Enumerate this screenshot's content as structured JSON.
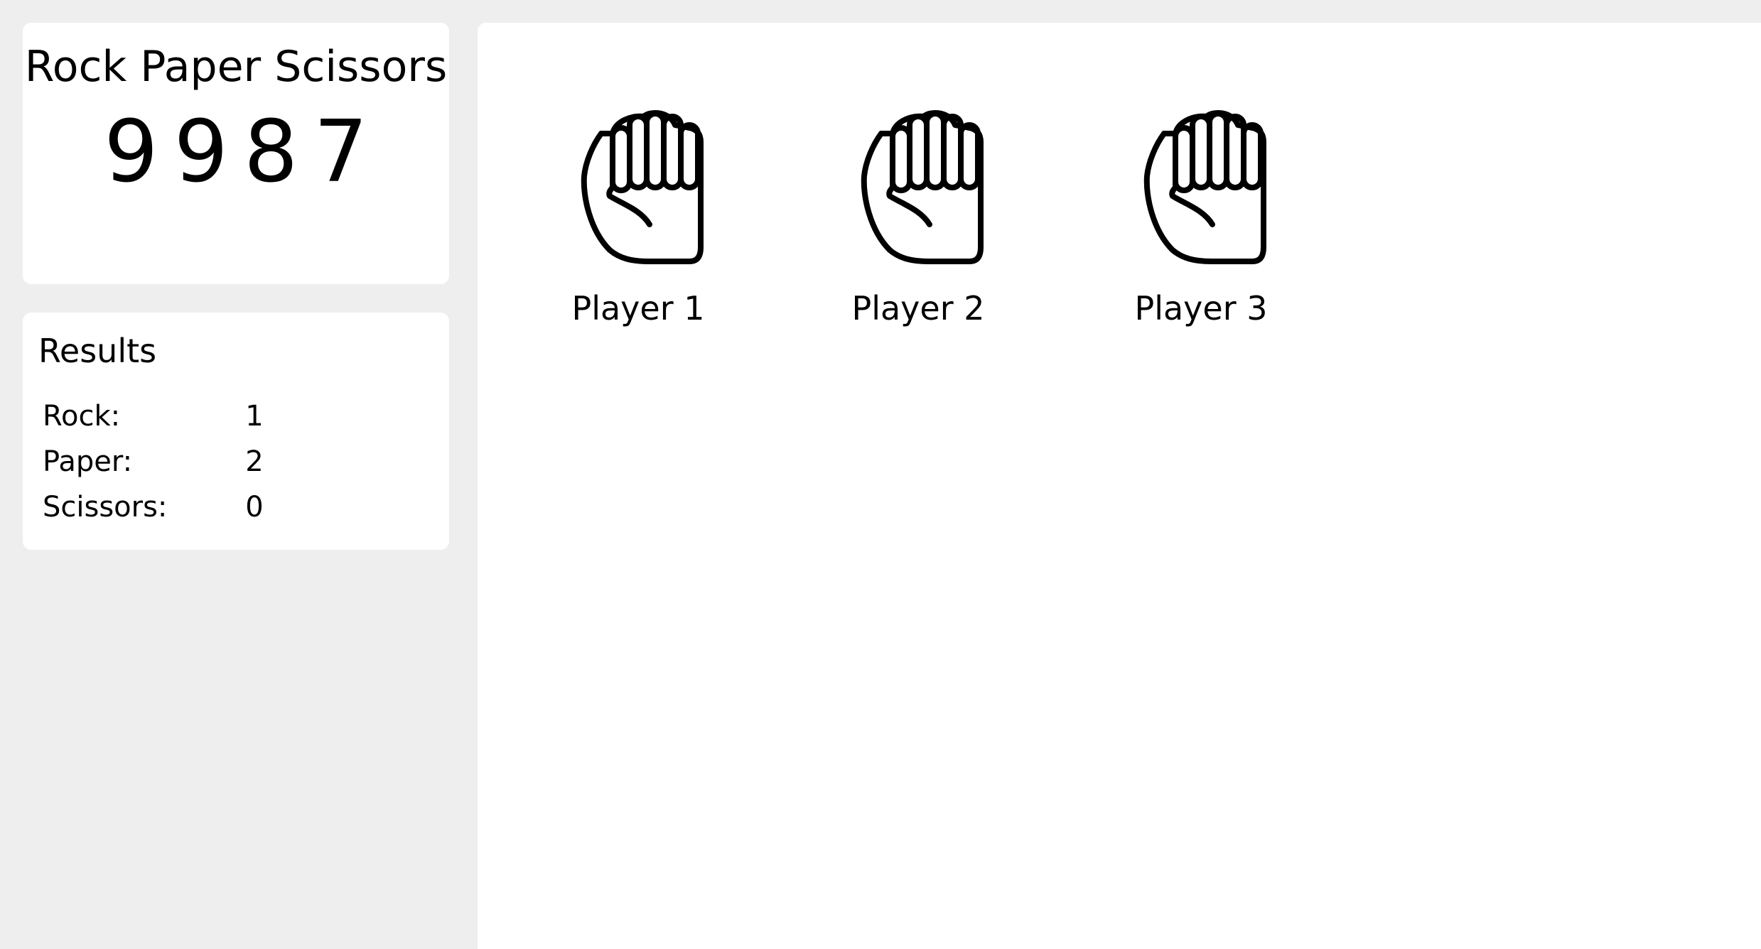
{
  "sidebar": {
    "title": "Rock Paper Scissors",
    "score": "9987",
    "results": {
      "heading": "Results",
      "rows": [
        {
          "label": "Rock:",
          "value": "1"
        },
        {
          "label": "Paper:",
          "value": "2"
        },
        {
          "label": "Scissors:",
          "value": "0"
        }
      ]
    }
  },
  "players": [
    {
      "name": "Player 1",
      "hand": "rock",
      "icon": "fist-icon"
    },
    {
      "name": "Player 2",
      "hand": "rock",
      "icon": "fist-icon"
    },
    {
      "name": "Player 3",
      "hand": "rock",
      "icon": "fist-icon"
    }
  ]
}
